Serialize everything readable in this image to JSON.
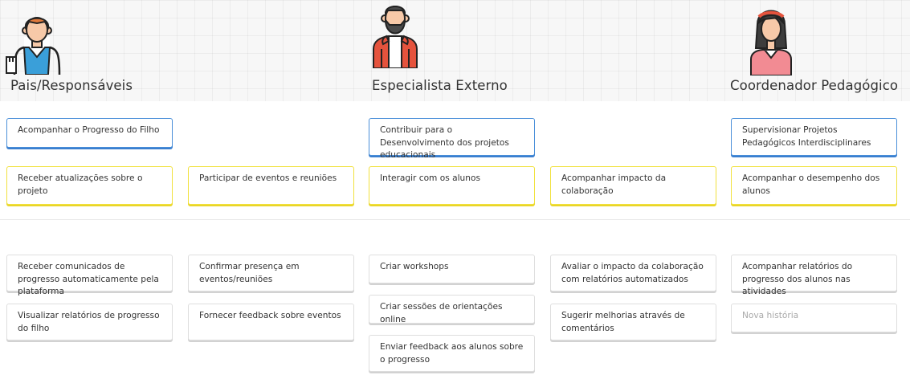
{
  "colors": {
    "activity_border": "#4a8fd9",
    "step_border": "#f1e13d",
    "story_border": "#dedede",
    "placeholder_text": "#a9a9a9"
  },
  "personas": [
    {
      "name": "Pais/Responsáveis",
      "icon": "parent-avatar-icon"
    },
    {
      "name": "Especialista Externo",
      "icon": "bearded-specialist-avatar-icon"
    },
    {
      "name": "Coordenador Pedagógico",
      "icon": "woman-coordinator-avatar-icon"
    }
  ],
  "activities": [
    "Acompanhar o Progresso do Filho",
    "Contribuir para o Desenvolvimento dos projetos educacionais",
    "Supervisionar Projetos Pedagógicos Interdisciplinares"
  ],
  "steps": [
    "Receber atualizações sobre o projeto",
    "Participar de eventos e reuniões",
    "Interagir com os alunos",
    "Acompanhar impacto da colaboração",
    "Acompanhar o desempenho dos alunos"
  ],
  "stories": [
    [
      "Receber comunicados de progresso automaticamente pela plataforma",
      "Visualizar relatórios de progresso do filho"
    ],
    [
      "Confirmar presença em eventos/reuniões",
      "Fornecer feedback sobre eventos"
    ],
    [
      "Criar workshops",
      "Criar sessões de orientações online",
      "Enviar feedback aos alunos sobre o progresso"
    ],
    [
      "Avaliar o impacto da colaboração com relatórios automatizados",
      "Sugerir melhorias através de comentários"
    ],
    [
      "Acompanhar relatórios do progresso dos alunos nas atividades",
      "Nova história"
    ]
  ]
}
